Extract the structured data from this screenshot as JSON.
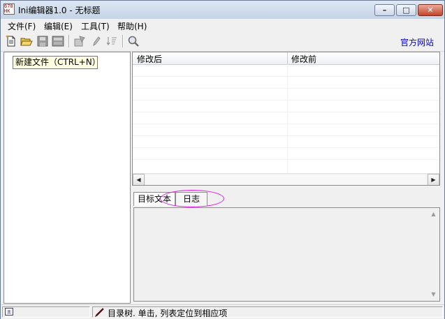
{
  "window": {
    "title": "Ini编辑器1.0 - 无标题",
    "app_icon_lines": [
      "670",
      "HK"
    ],
    "controls": {
      "minimize": "–",
      "maximize": "□",
      "close": "✕"
    }
  },
  "menu": [
    {
      "label": "文件(F)"
    },
    {
      "label": "编辑(E)"
    },
    {
      "label": "工具(T)"
    },
    {
      "label": "帮助(H)"
    }
  ],
  "toolbar": {
    "buttons": [
      {
        "name": "new-file",
        "icon": "new-file-icon"
      },
      {
        "name": "open-folder",
        "icon": "folder-open-icon"
      },
      {
        "name": "save",
        "icon": "save-icon"
      },
      {
        "name": "save-all",
        "icon": "save-all-icon"
      },
      {
        "name": "add-section",
        "icon": "add-section-icon"
      },
      {
        "name": "edit",
        "icon": "pencil-icon"
      },
      {
        "name": "sort",
        "icon": "sort-icon"
      },
      {
        "name": "search",
        "icon": "magnifier-icon"
      }
    ],
    "official_site": "官方网站",
    "tooltip": "新建文件（CTRL+N）"
  },
  "grid": {
    "columns": [
      "修改后",
      "修改前"
    ]
  },
  "tabs": [
    {
      "label": "目标文本",
      "active": true
    },
    {
      "label": "日志",
      "active": false
    }
  ],
  "status": {
    "text": "目录树. 单击, 列表定位到相应项",
    "left_icon": "tree-expand-icon"
  },
  "colors": {
    "link": "#0000cc",
    "highlight_oval": "#e020e0",
    "tooltip_bg": "#ffffe1"
  }
}
